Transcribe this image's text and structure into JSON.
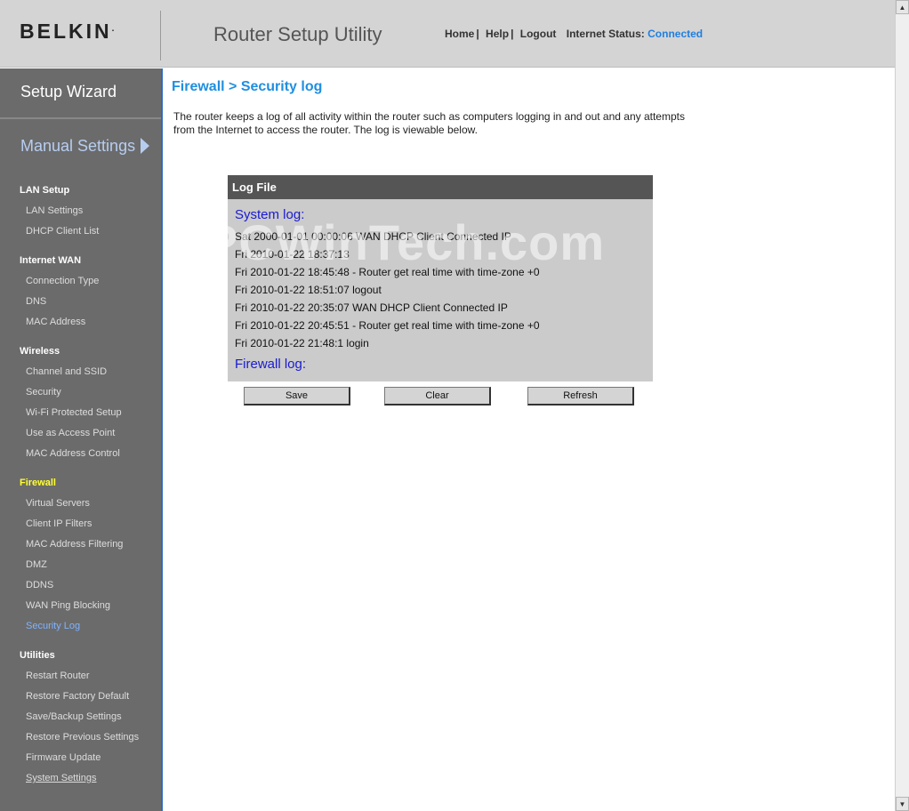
{
  "header": {
    "brand": "BELKIN",
    "brand_mark": ".",
    "app_title": "Router Setup Utility",
    "nav": {
      "home": "Home",
      "help": "Help",
      "logout": "Logout",
      "sep": "|",
      "status_label": "Internet Status:",
      "status_value": "Connected"
    }
  },
  "sidebar": {
    "wizard_label": "Setup Wizard",
    "manual_label": "Manual Settings",
    "sections": {
      "lan": {
        "title": "LAN Setup",
        "items": [
          "LAN Settings",
          "DHCP Client List"
        ]
      },
      "wan": {
        "title": "Internet WAN",
        "items": [
          "Connection Type",
          "DNS",
          "MAC Address"
        ]
      },
      "wireless": {
        "title": "Wireless",
        "items": [
          "Channel and SSID",
          "Security",
          "Wi-Fi Protected Setup",
          "Use as Access Point",
          "MAC Address Control"
        ]
      },
      "firewall": {
        "title": "Firewall",
        "items": [
          "Virtual Servers",
          "Client IP Filters",
          "MAC Address Filtering",
          "DMZ",
          "DDNS",
          "WAN Ping Blocking",
          "Security Log"
        ]
      },
      "utilities": {
        "title": "Utilities",
        "items": [
          "Restart Router",
          "Restore Factory Default",
          "Save/Backup Settings",
          "Restore Previous Settings",
          "Firmware Update",
          "System Settings"
        ]
      }
    }
  },
  "main": {
    "breadcrumb": "Firewall > Security log",
    "intro": "The router keeps a log of all activity within the router such as computers logging in and out and any attempts from the Internet to access the router. The log is viewable below.",
    "log": {
      "title": "Log File",
      "system_heading": "System log:",
      "lines": [
        "Sat 2000-01-01 00:00:06 WAN DHCP Client Connected IP",
        "Fri 2010-01-22 18:37:13",
        "Fri 2010-01-22 18:45:48 - Router get real time with time-zone +0",
        "Fri 2010-01-22 18:51:07 logout",
        "Fri 2010-01-22 20:35:07 WAN DHCP Client Connected IP",
        "Fri 2010-01-22 20:45:51 - Router get real time with time-zone +0",
        "Fri 2010-01-22 21:48:1 login"
      ],
      "firewall_heading": "Firewall log:"
    },
    "buttons": {
      "save": "Save",
      "clear": "Clear",
      "refresh": "Refresh"
    },
    "watermark": "PCWinTech.com"
  },
  "colors": {
    "accent": "#1f8fe0",
    "sidebar_bg": "#6b6b6b",
    "active_section": "#ffff33"
  }
}
